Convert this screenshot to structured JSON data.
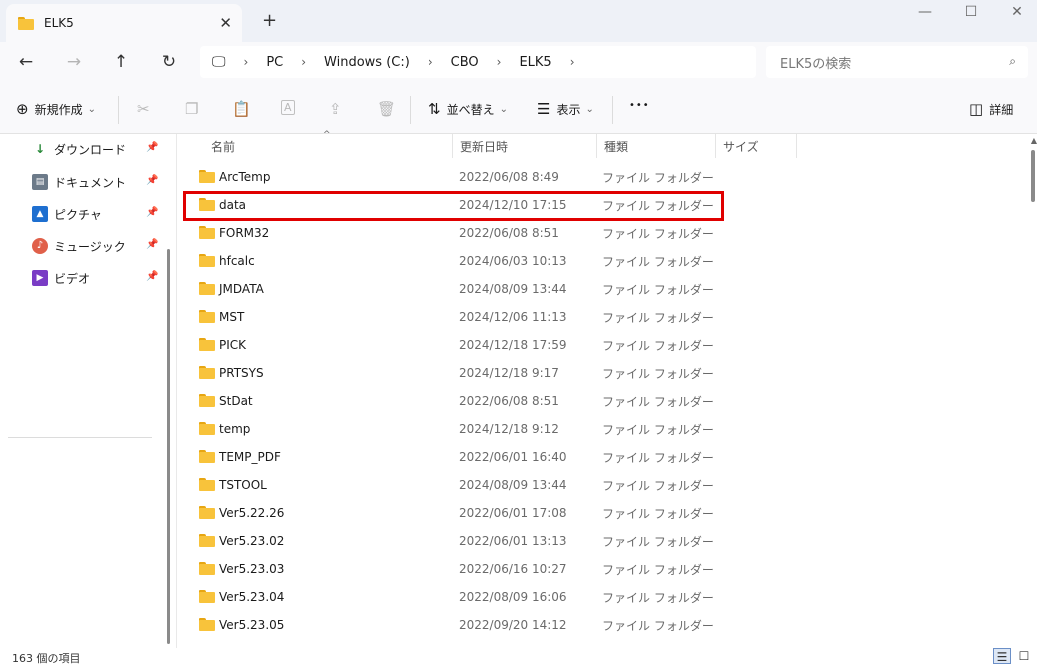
{
  "window": {
    "tab_title": "ELK5",
    "tab_close": "✕",
    "new_tab": "+",
    "minimize": "—",
    "maximize": "☐",
    "close": "✕"
  },
  "nav": {
    "back": "←",
    "forward": "→",
    "up": "↑",
    "refresh": "↻",
    "computer_icon": "🖵",
    "breadcrumbs": [
      "PC",
      "Windows (C:)",
      "CBO",
      "ELK5"
    ],
    "separator": "›",
    "search_placeholder": "ELK5の検索",
    "search_icon": "⌕"
  },
  "toolbar": {
    "new_label": "新規作成",
    "new_icon": "⊕",
    "cut_icon": "✂",
    "copy_icon": "❐",
    "paste_icon": "📋",
    "rename_icon": "A",
    "share_icon": "⇪",
    "delete_icon": "🗑",
    "sort_label": "並べ替え",
    "sort_icon": "⇅",
    "view_label": "表示",
    "view_icon": "☰",
    "more": "•••",
    "details_label": "詳細",
    "details_icon": "◫",
    "caret": "⌄"
  },
  "sidebar": {
    "items": [
      {
        "label": "ダウンロード",
        "icon": "↓",
        "color": "#2a8a3a"
      },
      {
        "label": "ドキュメント",
        "icon": "▤",
        "color": "#6c7a89"
      },
      {
        "label": "ピクチャ",
        "icon": "▲",
        "color": "#1e6fd0"
      },
      {
        "label": "ミュージック",
        "icon": "♪",
        "color": "#e0604a"
      },
      {
        "label": "ビデオ",
        "icon": "▶",
        "color": "#7a3cc5"
      }
    ],
    "pin_icon": "📌"
  },
  "columns": {
    "name": "名前",
    "modified": "更新日時",
    "type": "種類",
    "size": "サイズ",
    "sort_caret": "^"
  },
  "files": [
    {
      "name": "ArcTemp",
      "modified": "2022/06/08 8:49",
      "type": "ファイル フォルダー"
    },
    {
      "name": "data",
      "modified": "2024/12/10 17:15",
      "type": "ファイル フォルダー"
    },
    {
      "name": "FORM32",
      "modified": "2022/06/08 8:51",
      "type": "ファイル フォルダー"
    },
    {
      "name": "hfcalc",
      "modified": "2024/06/03 10:13",
      "type": "ファイル フォルダー"
    },
    {
      "name": "JMDATA",
      "modified": "2024/08/09 13:44",
      "type": "ファイル フォルダー"
    },
    {
      "name": "MST",
      "modified": "2024/12/06 11:13",
      "type": "ファイル フォルダー"
    },
    {
      "name": "PICK",
      "modified": "2024/12/18 17:59",
      "type": "ファイル フォルダー"
    },
    {
      "name": "PRTSYS",
      "modified": "2024/12/18 9:17",
      "type": "ファイル フォルダー"
    },
    {
      "name": "StDat",
      "modified": "2022/06/08 8:51",
      "type": "ファイル フォルダー"
    },
    {
      "name": "temp",
      "modified": "2024/12/18 9:12",
      "type": "ファイル フォルダー"
    },
    {
      "name": "TEMP_PDF",
      "modified": "2022/06/01 16:40",
      "type": "ファイル フォルダー"
    },
    {
      "name": "TSTOOL",
      "modified": "2024/08/09 13:44",
      "type": "ファイル フォルダー"
    },
    {
      "name": "Ver5.22.26",
      "modified": "2022/06/01 17:08",
      "type": "ファイル フォルダー"
    },
    {
      "name": "Ver5.23.02",
      "modified": "2022/06/01 13:13",
      "type": "ファイル フォルダー"
    },
    {
      "name": "Ver5.23.03",
      "modified": "2022/06/16 10:27",
      "type": "ファイル フォルダー"
    },
    {
      "name": "Ver5.23.04",
      "modified": "2022/08/09 16:06",
      "type": "ファイル フォルダー"
    },
    {
      "name": "Ver5.23.05",
      "modified": "2022/09/20 14:12",
      "type": "ファイル フォルダー"
    }
  ],
  "status": {
    "item_count": "163 個の項目",
    "details_view_icon": "☰",
    "tiles_view_icon": "☐"
  },
  "colors": {
    "highlight": "#e00000",
    "folder": "#f8c33b"
  }
}
